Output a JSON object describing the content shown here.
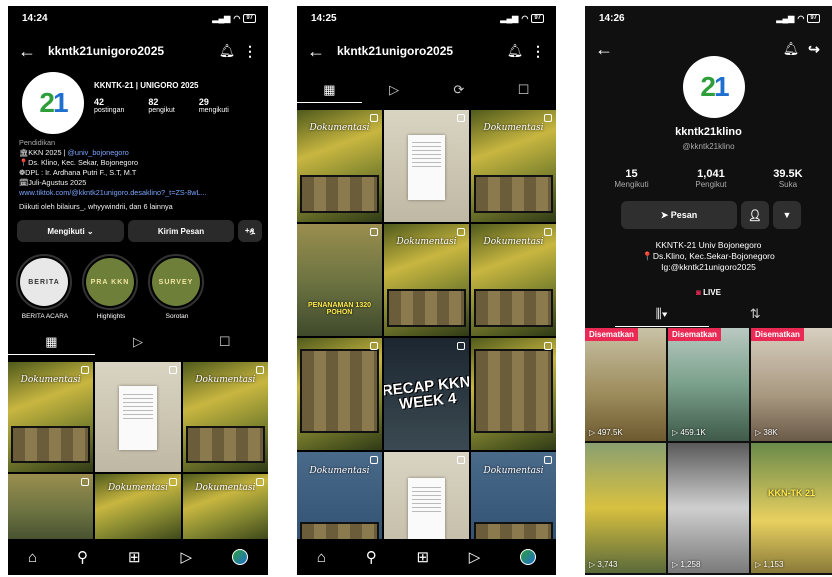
{
  "instagram_profile": {
    "status": {
      "time": "14:24",
      "battery": "97"
    },
    "username": "kkntk21unigoro2025",
    "name": "KKNTK-21 | UNIGORO 2025",
    "stats": [
      {
        "value": "42",
        "label": "postingan"
      },
      {
        "value": "82",
        "label": "pengikut"
      },
      {
        "value": "29",
        "label": "mengikuti"
      }
    ],
    "bio": {
      "category": "Pendidikan",
      "line1_prefix": "🏛KKN 2025 | ",
      "line1_mention": "@univ_bojonegoro",
      "line2": "📍Ds. Klino, Kec. Sekar, Bojonegoro",
      "line3": "❁DPL : Ir. Ardhana Putri F., S.T, M.T",
      "line4": "🗓Juli-Agustus 2025",
      "link": "www.tiktok.com/@kkntk21unigoro.desaklino?_t=ZS-8wL..."
    },
    "followed_by": "Diikuti oleh bilaiurs_, whyywindrii, dan 6 lainnya",
    "buttons": {
      "following": "Mengikuti ⌄",
      "message": "Kirim Pesan",
      "add_person": "+ዿ"
    },
    "highlights": [
      {
        "cover": "BERITA",
        "label": "BERITA ACARA"
      },
      {
        "cover": "PRA KKN",
        "label": "Highlights"
      },
      {
        "cover": "SURVEY",
        "label": "Sorotan"
      }
    ],
    "tabs": [
      "▦",
      "▷",
      "☐"
    ]
  },
  "instagram_grid": {
    "status": {
      "time": "14:25",
      "battery": "97"
    },
    "username": "kkntk21unigoro2025",
    "tabs": [
      "▦",
      "▷",
      "⟳",
      "☐"
    ],
    "recap_text": "RECAP KKN WEEK 4",
    "planting_text": "PENANAMAN 1320 POHON"
  },
  "tiktok_profile": {
    "status": {
      "time": "14:26",
      "battery": "97"
    },
    "name": "kkntk21klino",
    "handle": "@kkntk21klino",
    "stats": [
      {
        "value": "15",
        "label": "Mengikuti"
      },
      {
        "value": "1,041",
        "label": "Pengikut"
      },
      {
        "value": "39.5K",
        "label": "Suka"
      }
    ],
    "message_button": "Pesan",
    "bio_lines": [
      "KKNTK-21 Univ Bojonegoro",
      "📍Ds.Klino, Kec.Sekar-Bojonegoro",
      "Ig:@kkntk21unigoro2025"
    ],
    "live_label": "LIVE",
    "pinned_label": "Disematkan",
    "videos": [
      {
        "views": "497.5K",
        "pinned": true
      },
      {
        "views": "459.1K",
        "pinned": true
      },
      {
        "views": "38K",
        "pinned": true
      },
      {
        "views": "3,743",
        "pinned": false
      },
      {
        "views": "1,258",
        "pinned": false
      },
      {
        "views": "1,153",
        "pinned": false
      }
    ],
    "overlay_caption": "KKN-TK 21"
  }
}
